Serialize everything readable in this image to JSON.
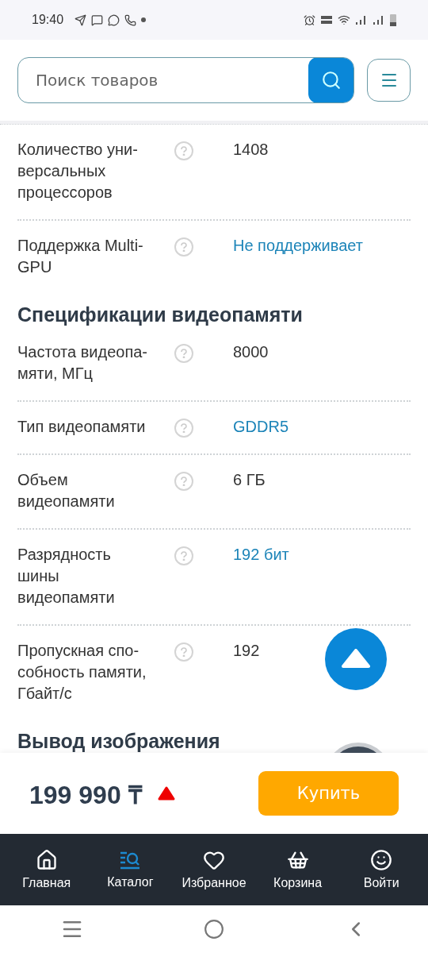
{
  "status_bar": {
    "time": "19:40"
  },
  "header": {
    "search": {
      "placeholder": "Поиск товаров"
    }
  },
  "sections": [
    {
      "rows": [
        {
          "label": "Количество уни-\nверсальных\nпроцессоров",
          "value": "1408",
          "link": false
        },
        {
          "label": "Поддержка Multi-\nGPU",
          "value": "Не поддерживает",
          "link": true
        }
      ]
    },
    {
      "title": "Спецификации видеопамяти",
      "rows": [
        {
          "label": "Частота видеопа-\nмяти, МГц",
          "value": "8000",
          "link": false
        },
        {
          "label": "Тип видеопамяти",
          "value": "GDDR5",
          "link": true
        },
        {
          "label": "Объем\nвидеопамяти",
          "value": "6 ГБ",
          "link": false
        },
        {
          "label": "Разрядность\nшины\nвидеопамяти",
          "value": "192 бит",
          "link": true
        },
        {
          "label": "Пропускная спо-\nсобность памяти,\nГбайт/с",
          "value": "192",
          "link": false
        }
      ]
    },
    {
      "title": "Вывод изображения"
    }
  ],
  "price_bar": {
    "price": "199 990 ₸",
    "buy_button": "Купить"
  },
  "bottom_nav": [
    {
      "kind": "home",
      "label": "Главная",
      "selected": false
    },
    {
      "kind": "catalog",
      "label": "Каталог",
      "selected": true
    },
    {
      "kind": "favorites",
      "label": "Избранное",
      "selected": false
    },
    {
      "kind": "cart",
      "label": "Корзина",
      "selected": false
    },
    {
      "kind": "login",
      "label": "Войти",
      "selected": false
    }
  ]
}
